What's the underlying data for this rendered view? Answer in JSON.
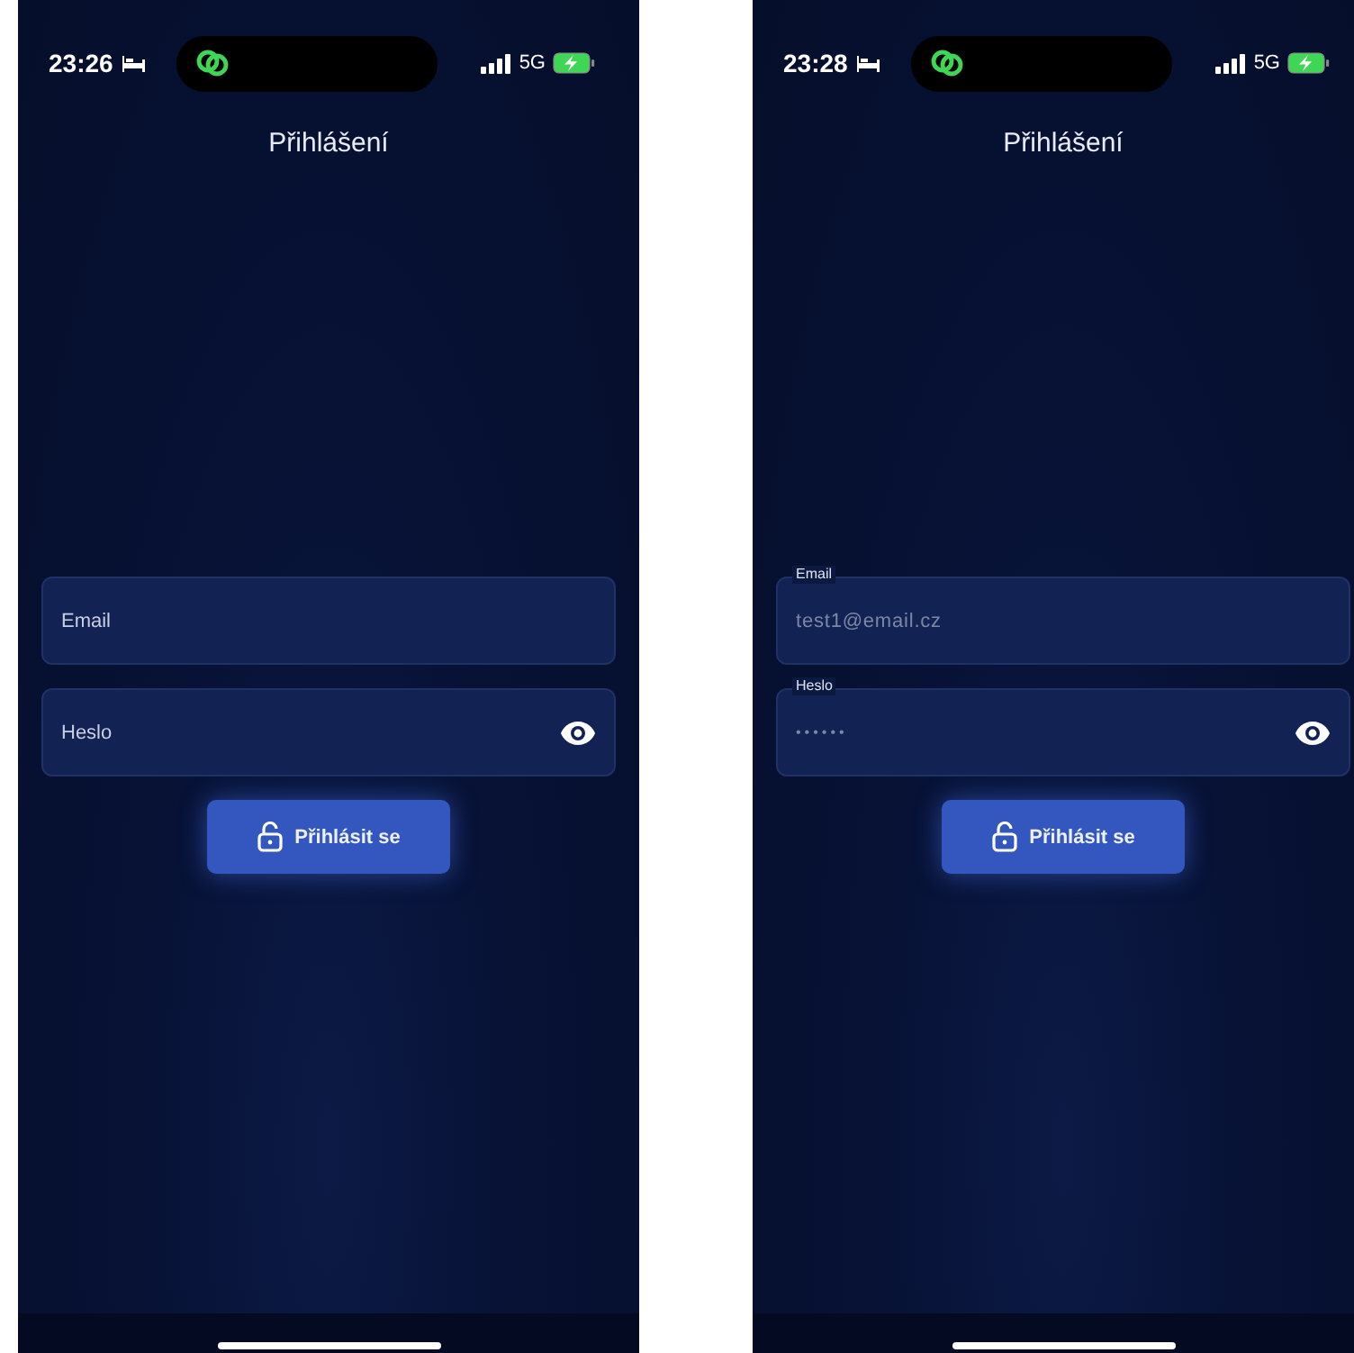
{
  "screens": [
    {
      "status_bar": {
        "time": "23:26",
        "network": "5G"
      },
      "title": "Přihlášení",
      "fields": [
        {
          "kind": "text",
          "placeholder": "Email"
        },
        {
          "kind": "password",
          "placeholder": "Heslo"
        }
      ],
      "button": {
        "label": "Přihlásit se"
      }
    },
    {
      "status_bar": {
        "time": "23:28",
        "network": "5G"
      },
      "title": "Přihlášení",
      "fields": [
        {
          "kind": "text",
          "label": "Email",
          "value": "test1@email.cz"
        },
        {
          "kind": "password",
          "label": "Heslo",
          "value": "••••••"
        }
      ],
      "button": {
        "label": "Přihlásit se"
      }
    }
  ]
}
